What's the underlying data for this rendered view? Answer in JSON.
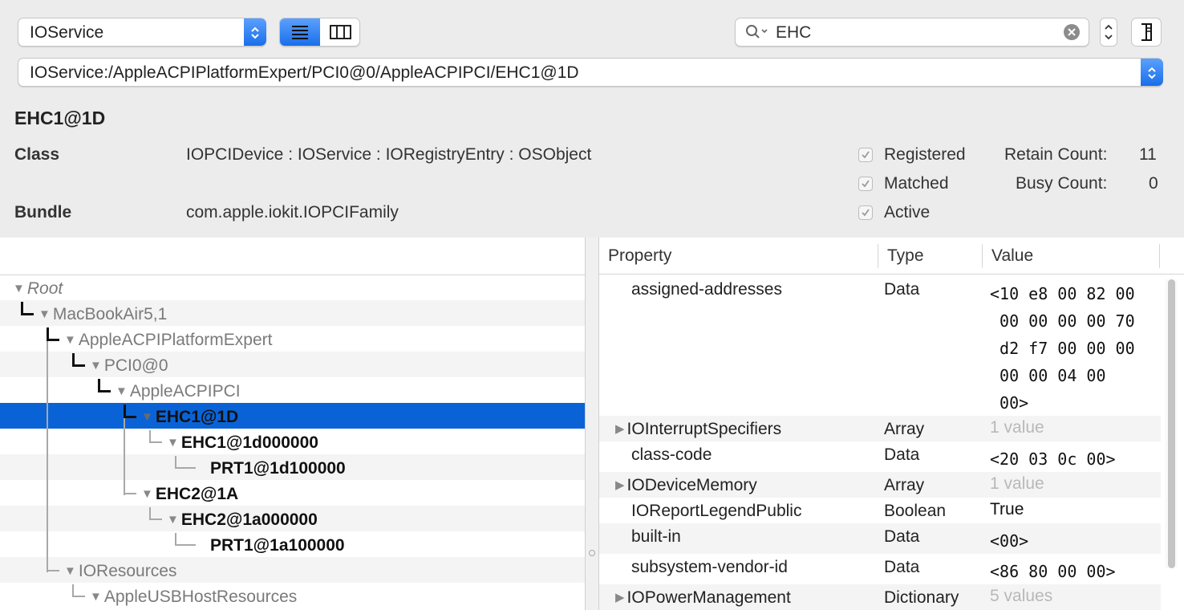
{
  "toolbar": {
    "plane_popup": "IOService",
    "search_value": "EHC",
    "path": "IOService:/AppleACPIPlatformExpert/PCI0@0/AppleACPIPCI/EHC1@1D"
  },
  "info": {
    "title": "EHC1@1D",
    "class_label": "Class",
    "class_value": "IOPCIDevice : IOService : IORegistryEntry : OSObject",
    "bundle_label": "Bundle",
    "bundle_value": "com.apple.iokit.IOPCIFamily",
    "registered": "Registered",
    "matched": "Matched",
    "active": "Active",
    "retain_label": "Retain Count:",
    "retain_value": "11",
    "busy_label": "Busy Count:",
    "busy_value": "0"
  },
  "tree": [
    {
      "label": "Root"
    },
    {
      "label": "MacBookAir5,1"
    },
    {
      "label": "AppleACPIPlatformExpert"
    },
    {
      "label": "PCI0@0"
    },
    {
      "label": "AppleACPIPCI"
    },
    {
      "label": "EHC1@1D"
    },
    {
      "label": "EHC1@1d000000"
    },
    {
      "label": "PRT1@1d100000"
    },
    {
      "label": "EHC2@1A"
    },
    {
      "label": "EHC2@1a000000"
    },
    {
      "label": "PRT1@1a100000"
    },
    {
      "label": "IOResources"
    },
    {
      "label": "AppleUSBHostResources"
    }
  ],
  "props": {
    "headers": {
      "property": "Property",
      "type": "Type",
      "value": "Value"
    },
    "rows": [
      {
        "name": "assigned-addresses",
        "type": "Data",
        "value": "<10 e8 00 82 00\n 00 00 00 00 70\n d2 f7 00 00 00\n 00 00 04 00\n 00>"
      },
      {
        "name": "IOInterruptSpecifiers",
        "type": "Array",
        "value": "1 value"
      },
      {
        "name": "class-code",
        "type": "Data",
        "value": "<20 03 0c 00>"
      },
      {
        "name": "IODeviceMemory",
        "type": "Array",
        "value": "1 value"
      },
      {
        "name": "IOReportLegendPublic",
        "type": "Boolean",
        "value": "True"
      },
      {
        "name": "built-in",
        "type": "Data",
        "value": "<00>"
      },
      {
        "name": "subsystem-vendor-id",
        "type": "Data",
        "value": "<86 80 00 00>"
      },
      {
        "name": "IOPowerManagement",
        "type": "Dictionary",
        "value": "5 values"
      }
    ]
  }
}
